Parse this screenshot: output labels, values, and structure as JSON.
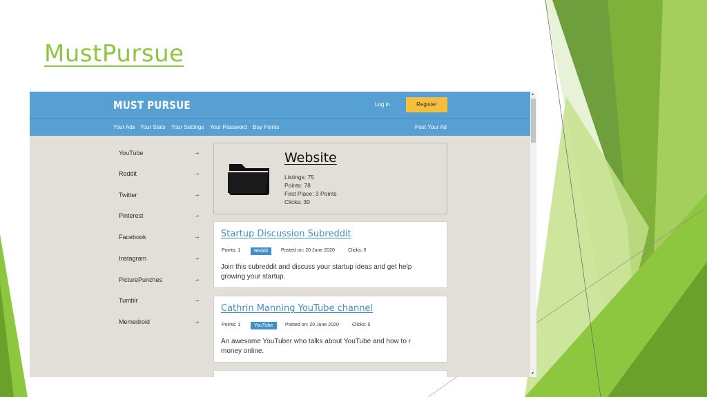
{
  "slide": {
    "title": "MustPursue",
    "accent_colors": [
      "#8dc63f",
      "#6aa12a",
      "#b5d97a"
    ]
  },
  "site": {
    "logo": "MUST PURSUE",
    "login": "Log in",
    "register": "Register",
    "nav": [
      "Your Ads",
      "Your Stats",
      "Your Settings",
      "Your Password",
      "Buy Points"
    ],
    "post_ad": "Post Your Ad",
    "header_color": "#56a0d3",
    "register_color": "#f6be3c"
  },
  "categories": [
    {
      "label": "YouTube",
      "arrow": "→"
    },
    {
      "label": "Reddit",
      "arrow": "→"
    },
    {
      "label": "Twitter",
      "arrow": "→"
    },
    {
      "label": "Pinterest",
      "arrow": "→"
    },
    {
      "label": "Facebook",
      "arrow": "→"
    },
    {
      "label": "Instagram",
      "arrow": "→"
    },
    {
      "label": "PicturePunches",
      "arrow": "→"
    },
    {
      "label": "Tumblr",
      "arrow": "→"
    },
    {
      "label": "Memedroid",
      "arrow": "→"
    }
  ],
  "featured": {
    "icon": "folder-icon",
    "title": "Website",
    "lines": [
      "Listings: 75",
      "Points: 78",
      "First Place: 3 Points",
      "Clicks: 30"
    ]
  },
  "ads": [
    {
      "title": "Startup Discussion Subreddit",
      "points": "Points: 1",
      "badge": "Reddit",
      "posted": "Posted on: 20 June 2020",
      "clicks": "Clicks: 0",
      "description_lines": [
        "Join this subreddit and discuss your startup ideas and get help",
        "growing your startup."
      ]
    },
    {
      "title": "Cathrin Manning YouTube channel",
      "points": "Points: 1",
      "badge": "YouTube",
      "posted": "Posted on: 20 June 2020",
      "clicks": "Clicks: 0",
      "description_lines": [
        "An awesome YouTuber who talks about YouTube and how to r",
        "money online."
      ]
    }
  ]
}
